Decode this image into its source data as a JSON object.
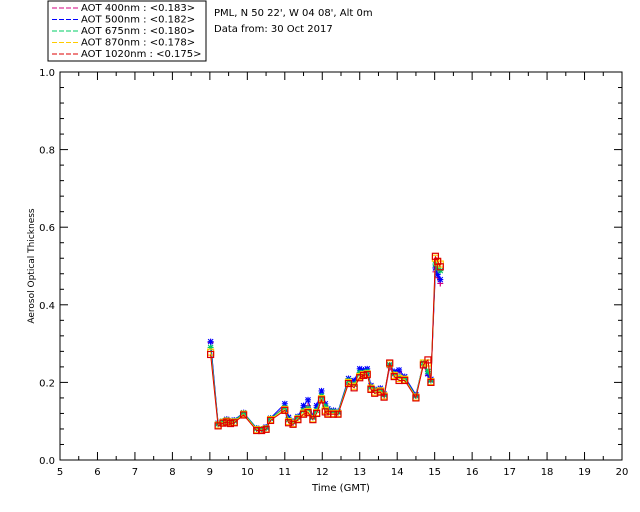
{
  "header": {
    "site_line": "PML, N 50 22', W 04 08', Alt 0m",
    "date_line": "Data from: 30 Oct 2017"
  },
  "chart_data": {
    "type": "line",
    "xlabel": "Time (GMT)",
    "ylabel": "Aerosol Optical Thickness",
    "xlim": [
      5,
      20
    ],
    "ylim": [
      0.0,
      1.0
    ],
    "xticks": [
      "5",
      "6",
      "7",
      "8",
      "9",
      "10",
      "11",
      "12",
      "13",
      "14",
      "15",
      "16",
      "17",
      "18",
      "19",
      "20"
    ],
    "yticks": [
      "0.0",
      "0.2",
      "0.4",
      "0.6",
      "0.8",
      "1.0"
    ],
    "legend_position": "top-left, outside plot",
    "x": [
      9.02,
      9.22,
      9.35,
      9.45,
      9.55,
      9.65,
      9.9,
      10.25,
      10.38,
      10.5,
      10.62,
      11.0,
      11.1,
      11.22,
      11.35,
      11.5,
      11.62,
      11.75,
      11.85,
      11.98,
      12.08,
      12.15,
      12.3,
      12.42,
      12.7,
      12.85,
      13.0,
      13.1,
      13.2,
      13.3,
      13.4,
      13.55,
      13.65,
      13.8,
      13.92,
      14.05,
      14.2,
      14.5,
      14.7,
      14.82,
      14.9,
      15.02,
      15.08,
      15.15
    ],
    "series": [
      {
        "name": "AOT  400nm : <0.183>",
        "color": "#d00080",
        "marker": "+",
        "values": [
          0.303,
          0.092,
          0.098,
          0.104,
          0.098,
          0.1,
          0.12,
          0.08,
          0.078,
          0.082,
          0.106,
          0.138,
          0.105,
          0.095,
          0.108,
          0.135,
          0.14,
          0.11,
          0.135,
          0.16,
          0.14,
          0.128,
          0.125,
          0.122,
          0.205,
          0.2,
          0.225,
          0.225,
          0.23,
          0.19,
          0.178,
          0.18,
          0.165,
          0.238,
          0.22,
          0.228,
          0.21,
          0.165,
          0.245,
          0.218,
          0.205,
          0.485,
          0.47,
          0.455
        ]
      },
      {
        "name": "AOT  500nm : <0.182>",
        "color": "#0000ff",
        "marker": "*",
        "values": [
          0.305,
          0.095,
          0.1,
          0.105,
          0.1,
          0.103,
          0.122,
          0.082,
          0.08,
          0.085,
          0.108,
          0.145,
          0.11,
          0.1,
          0.112,
          0.14,
          0.155,
          0.112,
          0.14,
          0.178,
          0.145,
          0.132,
          0.128,
          0.125,
          0.21,
          0.205,
          0.235,
          0.232,
          0.235,
          0.192,
          0.182,
          0.185,
          0.17,
          0.245,
          0.228,
          0.232,
          0.215,
          0.168,
          0.25,
          0.222,
          0.208,
          0.495,
          0.478,
          0.465
        ]
      },
      {
        "name": "AOT  675nm : <0.180>",
        "color": "#00cc66",
        "marker": "*",
        "values": [
          0.29,
          0.093,
          0.1,
          0.103,
          0.099,
          0.101,
          0.121,
          0.081,
          0.08,
          0.083,
          0.107,
          0.135,
          0.104,
          0.098,
          0.11,
          0.128,
          0.133,
          0.11,
          0.128,
          0.165,
          0.138,
          0.128,
          0.125,
          0.123,
          0.205,
          0.195,
          0.225,
          0.225,
          0.228,
          0.188,
          0.18,
          0.18,
          0.168,
          0.245,
          0.222,
          0.215,
          0.21,
          0.165,
          0.25,
          0.228,
          0.205,
          0.505,
          0.495,
          0.488
        ]
      },
      {
        "name": "AOT  870nm : <0.178>",
        "color": "#ffcc00",
        "marker": "square",
        "values": [
          0.278,
          0.09,
          0.097,
          0.1,
          0.096,
          0.098,
          0.118,
          0.078,
          0.077,
          0.08,
          0.104,
          0.13,
          0.099,
          0.094,
          0.106,
          0.121,
          0.125,
          0.106,
          0.122,
          0.158,
          0.128,
          0.12,
          0.12,
          0.12,
          0.2,
          0.19,
          0.215,
          0.22,
          0.222,
          0.185,
          0.175,
          0.178,
          0.165,
          0.248,
          0.218,
          0.21,
          0.208,
          0.162,
          0.25,
          0.25,
          0.202,
          0.52,
          0.51,
          0.505
        ]
      },
      {
        "name": "AOT 1020nm : <0.175>",
        "color": "#dd0000",
        "marker": "square",
        "values": [
          0.272,
          0.088,
          0.095,
          0.098,
          0.094,
          0.096,
          0.116,
          0.076,
          0.076,
          0.079,
          0.102,
          0.128,
          0.096,
          0.092,
          0.104,
          0.118,
          0.122,
          0.104,
          0.12,
          0.155,
          0.124,
          0.118,
          0.118,
          0.118,
          0.197,
          0.186,
          0.212,
          0.218,
          0.22,
          0.182,
          0.172,
          0.175,
          0.162,
          0.25,
          0.215,
          0.205,
          0.205,
          0.16,
          0.245,
          0.258,
          0.2,
          0.525,
          0.512,
          0.498
        ]
      }
    ]
  }
}
